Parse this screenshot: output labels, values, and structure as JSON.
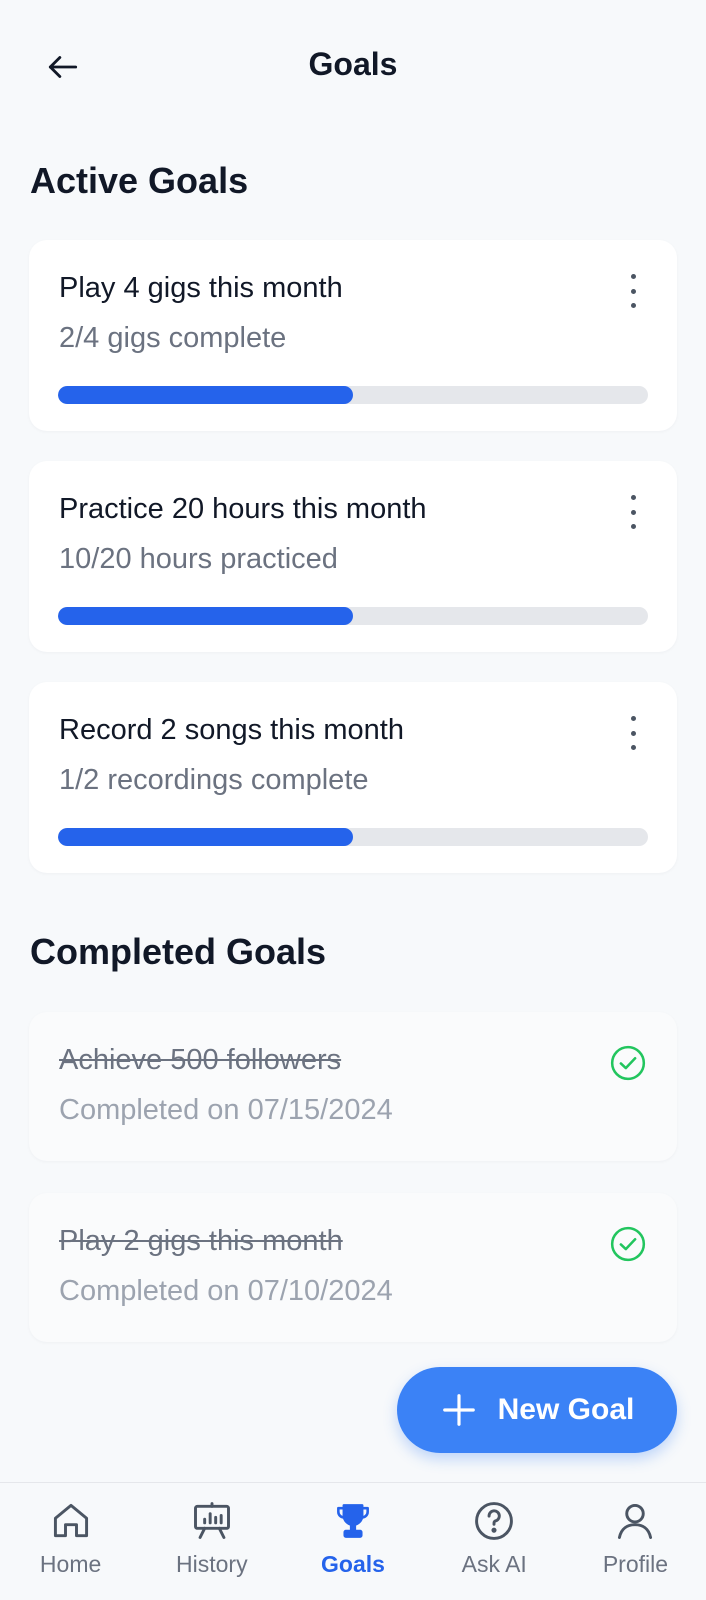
{
  "header": {
    "title": "Goals"
  },
  "active_section": {
    "title": "Active Goals"
  },
  "active_goals": [
    {
      "title": "Play 4 gigs this month",
      "subtitle": "2/4 gigs complete",
      "progress": 0.5
    },
    {
      "title": "Practice 20 hours this month",
      "subtitle": "10/20 hours practiced",
      "progress": 0.5
    },
    {
      "title": "Record 2 songs this month",
      "subtitle": "1/2 recordings complete",
      "progress": 0.5
    }
  ],
  "completed_section": {
    "title": "Completed Goals"
  },
  "completed_goals": [
    {
      "title": "Achieve 500 followers",
      "subtitle": "Completed on 07/15/2024"
    },
    {
      "title": "Play 2 gigs this month",
      "subtitle": "Completed on 07/10/2024"
    }
  ],
  "fab": {
    "label": "New Goal"
  },
  "nav": {
    "items": [
      {
        "label": "Home",
        "icon": "home-icon"
      },
      {
        "label": "History",
        "icon": "chart-board-icon"
      },
      {
        "label": "Goals",
        "icon": "trophy-icon",
        "active": true
      },
      {
        "label": "Ask AI",
        "icon": "question-circle-icon"
      },
      {
        "label": "Profile",
        "icon": "user-icon"
      }
    ]
  },
  "colors": {
    "accent": "#2563eb",
    "fab": "#3b82f6",
    "check": "#22c55e",
    "track": "#e5e7eb"
  }
}
